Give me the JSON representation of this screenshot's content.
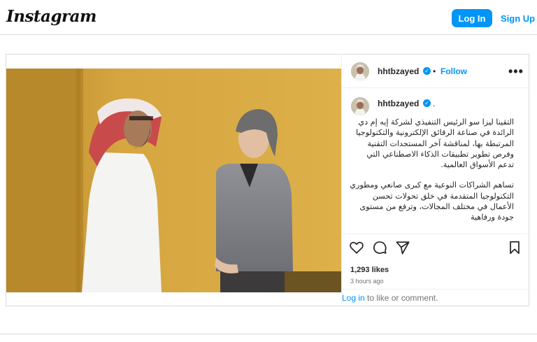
{
  "topbar": {
    "logo": "Instagram",
    "login_label": "Log In",
    "signup_label": "Sign Up"
  },
  "post": {
    "username": "hhtbzayed",
    "follow_label": "Follow",
    "separator": "•",
    "caption_dot": ".",
    "caption": [
      "التقينا ليزا سو الرئيس التنفيذي لشركة إيه إم دي الرائدة في صناعة الرقائق الإلكترونية والتكنولوجيا المرتبطة بها، لمناقشة آخر المستجدات التقنية وفرص تطوير تطبيقات الذكاء الاصطناعي التي تدعم الأسواق العالمية.",
      "تساهم الشراكات النوعية مع كبرى صانعي ومطوري التكنولوجيا المتقدمة في خلق تحولات تحسن الأعمال في مختلف المجالات، وترفع من مستوى جودة ورفاهية"
    ],
    "likes": "1,293 likes",
    "time": "3 hours ago",
    "login_link": "Log in",
    "login_rest": " to like or comment."
  },
  "icons": {
    "heart": "heart-icon",
    "comment": "comment-icon",
    "share": "share-icon",
    "save": "bookmark-icon",
    "more": "more-options-icon",
    "verified": "verified-badge-icon"
  },
  "colors": {
    "accent": "#0095f6",
    "border": "#dbdbdb",
    "muted": "#737373",
    "wall": "#d9a83b"
  }
}
